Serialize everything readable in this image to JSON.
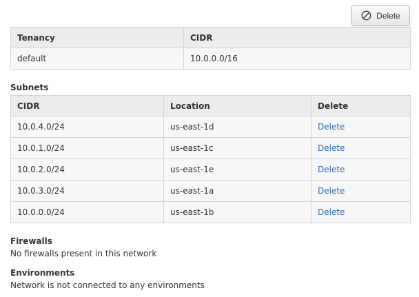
{
  "toolbar": {
    "delete_label": "Delete",
    "delete_icon": "prohibited-icon"
  },
  "tenancy_table": {
    "headers": [
      "Tenancy",
      "CIDR"
    ],
    "rows": [
      [
        "default",
        "10.0.0.0/16"
      ]
    ]
  },
  "subnets": {
    "title": "Subnets",
    "headers": [
      "CIDR",
      "Location",
      "Delete"
    ],
    "rows": [
      {
        "cidr": "10.0.4.0/24",
        "location": "us-east-1d",
        "action": "Delete"
      },
      {
        "cidr": "10.0.1.0/24",
        "location": "us-east-1c",
        "action": "Delete"
      },
      {
        "cidr": "10.0.2.0/24",
        "location": "us-east-1e",
        "action": "Delete"
      },
      {
        "cidr": "10.0.3.0/24",
        "location": "us-east-1a",
        "action": "Delete"
      },
      {
        "cidr": "10.0.0.0/24",
        "location": "us-east-1b",
        "action": "Delete"
      }
    ]
  },
  "firewalls": {
    "title": "Firewalls",
    "text": "No firewalls present in this network"
  },
  "environments": {
    "title": "Environments",
    "text": "Network is not connected to any environments"
  },
  "colors": {
    "link": "#2a6fb5",
    "header_bg": "#ececec",
    "cell_bg": "#f7f7f7",
    "border": "#d5d5d5"
  }
}
